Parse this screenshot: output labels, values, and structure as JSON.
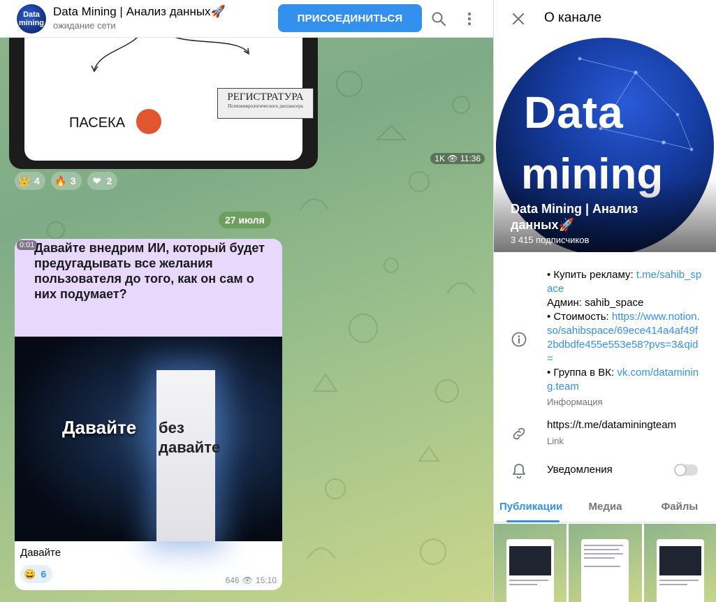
{
  "header": {
    "avatar_text": "Data mining",
    "title": "Data Mining | Анализ данных🚀",
    "status": "ожидание сети",
    "join_label": "ПРИСОЕДИНИТЬСЯ",
    "search_icon": "search-icon",
    "menu_icon": "more-vertical-icon"
  },
  "messages": [
    {
      "image_labels": {
        "paseka": "ПАСЕКА",
        "reg_title": "РЕГИСТРАТУРА",
        "reg_sub": "Психоневрологического диспансера"
      },
      "views": "1K",
      "time": "11:36",
      "reactions": [
        {
          "icon": "crown-icon",
          "count": "4"
        },
        {
          "icon": "fire-icon",
          "count": "3"
        },
        {
          "icon": "heart-fire-icon",
          "count": "2"
        }
      ]
    },
    {
      "video_duration": "0:01",
      "header_text": "Давайте внедрим ИИ, который будет предугадывать все желания пользователя до того, как он сам о них подумает?",
      "image_left_text": "Давайте",
      "image_right_text": "без давайте",
      "caption": "Давайте",
      "reaction": {
        "icon": "grinning-face-icon",
        "count": "6"
      },
      "views": "646",
      "time": "15:10"
    }
  ],
  "date_separator": "27 июля",
  "panel": {
    "title": "О канале",
    "cover_text_1": "Data",
    "cover_text_2": "mining",
    "channel_name": "Data Mining | Анализ данных🚀",
    "subscribers": "3 415 подписчиков",
    "info": {
      "ad_prefix": "• Купить рекламу: ",
      "ad_link": "t.me/sahib_space",
      "admin": "Админ: sahib_space",
      "cost_prefix": "• Стоимость: ",
      "cost_link": "https://www.notion.so/sahibspace/69ece414a4af49f2bdbdfe455e553e58?pvs=3&qid=",
      "vk_prefix": "• Группа в ВК: ",
      "vk_link": "vk.com/datamining.team",
      "caption": "Информация"
    },
    "link": "https://t.me/dataminingteam",
    "link_caption": "Link",
    "notifications_label": "Уведомления",
    "notifications_on": false,
    "tabs": [
      "Публикации",
      "Медиа",
      "Файлы"
    ],
    "accent": "#3390ec"
  }
}
